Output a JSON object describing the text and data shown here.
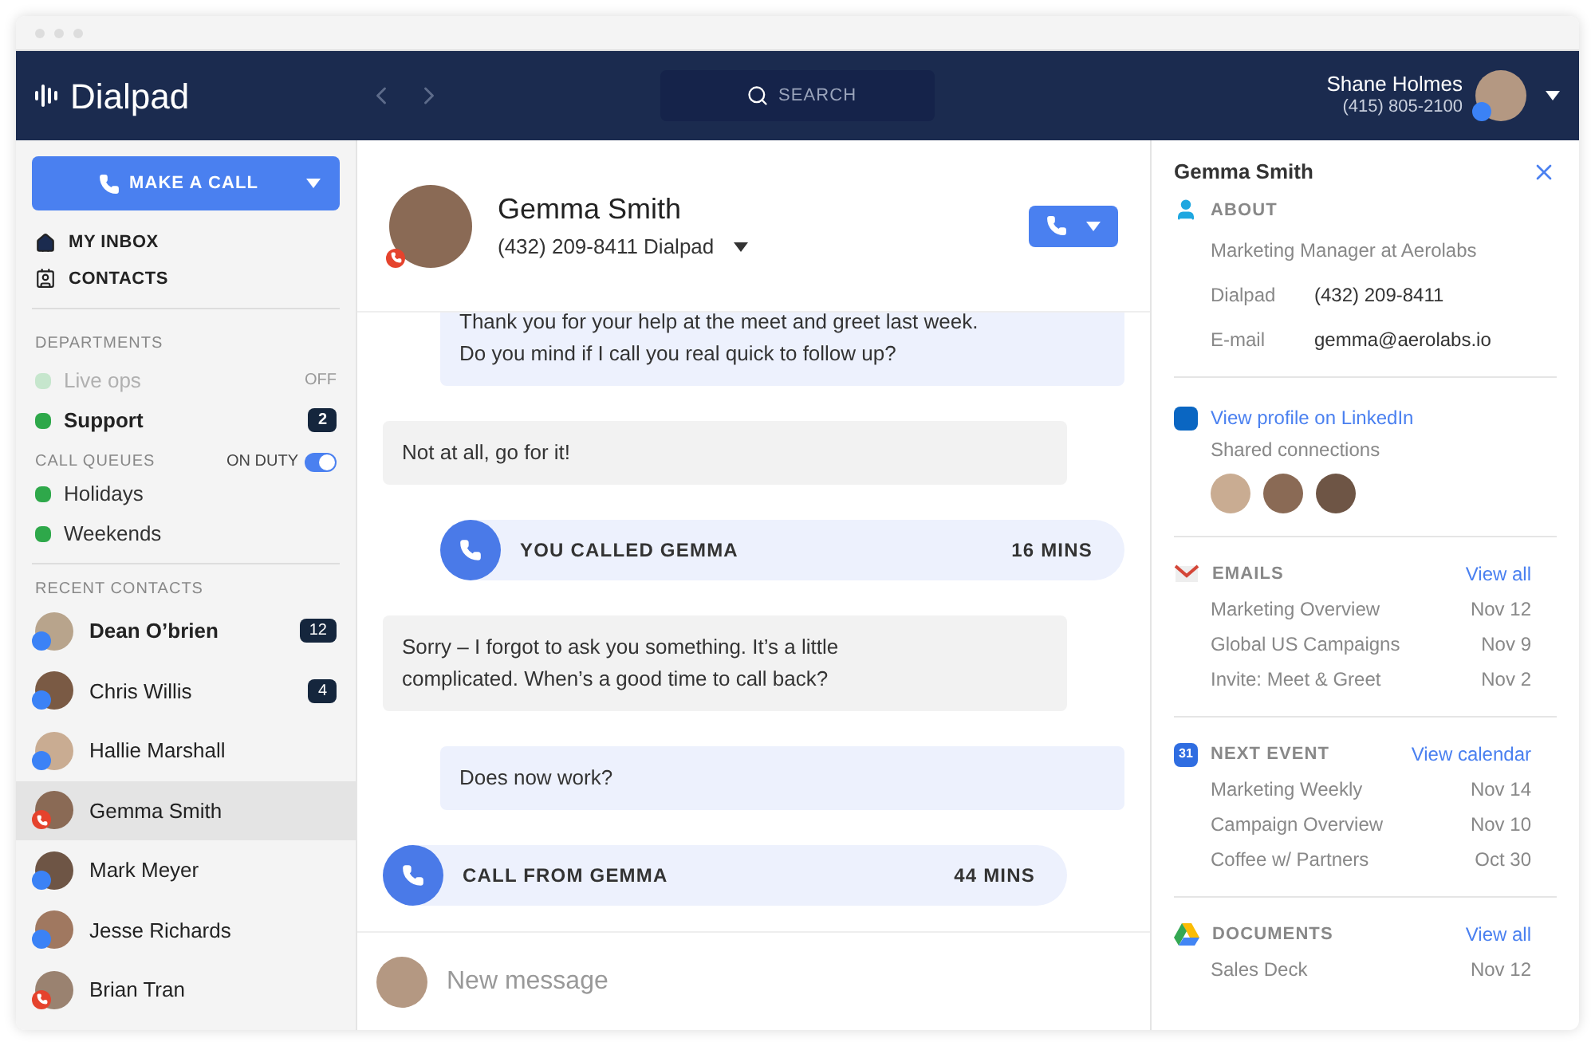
{
  "app": {
    "logo": "Dialpad",
    "search": {
      "placeholder": "SEARCH"
    },
    "user": {
      "name": "Shane Holmes",
      "phone": "(415) 805-2100",
      "on_call": false
    }
  },
  "sidebar": {
    "call_button": "MAKE A CALL",
    "nav": [
      {
        "kind": "inbox",
        "label": "MY INBOX"
      },
      {
        "kind": "contacts",
        "label": "CONTACTS"
      }
    ],
    "departments": {
      "title": "DEPARTMENTS",
      "items": [
        {
          "label": "Live ops",
          "disabled": true,
          "color": "#c6e6cd",
          "status": "OFF"
        },
        {
          "label": "Support",
          "disabled": false,
          "color": "#2ea84a",
          "count": "2"
        }
      ]
    },
    "call_queues": {
      "title": "CALL QUEUES",
      "duty_label": "ON DUTY",
      "on": true,
      "items": [
        {
          "label": "Holidays",
          "color": "#2ea84a"
        },
        {
          "label": "Weekends",
          "color": "#2ea84a"
        }
      ]
    },
    "recent_contacts": {
      "title": "RECENT CONTACTS",
      "items": [
        {
          "name": "Dean O’brien",
          "on_call": false,
          "unread": true,
          "count": "12",
          "selected": false
        },
        {
          "name": "Chris Willis",
          "on_call": false,
          "unread": false,
          "count": "4",
          "selected": false
        },
        {
          "name": "Hallie Marshall",
          "on_call": false,
          "unread": false,
          "selected": false
        },
        {
          "name": "Gemma Smith",
          "on_call": true,
          "unread": false,
          "selected": true
        },
        {
          "name": "Mark Meyer",
          "on_call": false,
          "unread": false,
          "selected": false
        },
        {
          "name": "Jesse Richards",
          "on_call": false,
          "unread": false,
          "selected": false
        },
        {
          "name": "Brian Tran",
          "on_call": true,
          "unread": false,
          "selected": false
        }
      ]
    }
  },
  "conversation": {
    "contact": {
      "name": "Gemma Smith",
      "phone": "(432) 209-8411 Dialpad",
      "on_call": true
    },
    "messages": [
      {
        "kind": "outgoing",
        "text": "Thank you for your help at the meet and greet last week.\nDo you mind if I call you real quick to follow up?"
      },
      {
        "kind": "incoming",
        "text": "Not at all, go for it!"
      },
      {
        "kind": "call_out",
        "label": "YOU CALLED GEMMA",
        "duration": "16 MINS"
      },
      {
        "kind": "incoming",
        "text": "Sorry – I forgot to ask you something. It’s a little\ncomplicated. When’s a good time to call back?"
      },
      {
        "kind": "outgoing",
        "text": "Does now work?"
      },
      {
        "kind": "call_in",
        "label": "CALL FROM GEMMA",
        "duration": "44 MINS"
      }
    ],
    "composer": {
      "placeholder": "New message"
    }
  },
  "details": {
    "name": "Gemma Smith",
    "about": {
      "title": "ABOUT",
      "job": "Marketing Manager at Aerolabs",
      "fields": [
        {
          "label": "Dialpad",
          "value": "(432) 209-8411"
        },
        {
          "label": "E-mail",
          "value": "gemma@aerolabs.io"
        }
      ]
    },
    "linkedin": {
      "link": "View profile on LinkedIn",
      "shared": "Shared connections"
    },
    "sections": [
      {
        "kind": "email",
        "title": "EMAILS",
        "link": "View all",
        "items": [
          {
            "label": "Marketing Overview",
            "date": "Nov 12"
          },
          {
            "label": "Global US Campaigns",
            "date": "Nov 9"
          },
          {
            "label": "Invite: Meet & Greet",
            "date": "Nov 2"
          }
        ]
      },
      {
        "kind": "calendar",
        "title": "NEXT EVENT",
        "link": "View calendar",
        "icon_text": "31",
        "items": [
          {
            "label": "Marketing Weekly",
            "date": "Nov 14"
          },
          {
            "label": "Campaign Overview",
            "date": "Nov 10"
          },
          {
            "label": "Coffee w/ Partners",
            "date": "Oct 30"
          }
        ]
      },
      {
        "kind": "drive",
        "title": "DOCUMENTS",
        "link": "View all",
        "items": [
          {
            "label": "Sales Deck",
            "date": "Nov 12"
          }
        ]
      }
    ]
  }
}
